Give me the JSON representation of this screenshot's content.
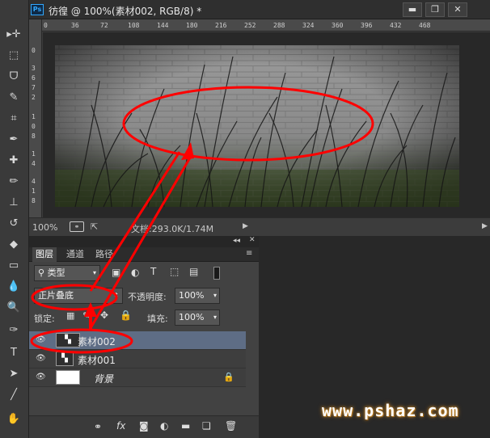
{
  "window": {
    "title": "彷徨 @ 100%(素材002, RGB/8) *",
    "app_badge": "Ps",
    "minimize": "▬",
    "restore": "❐",
    "close": "✕"
  },
  "rulers": {
    "h_ticks": [
      "0",
      "36",
      "72",
      "108",
      "144",
      "180",
      "216",
      "252",
      "288",
      "324",
      "360",
      "396",
      "432",
      "468"
    ],
    "v_ticks": [
      "0",
      "3",
      "6",
      "7",
      "2",
      "1",
      "0",
      "8",
      "1",
      "4",
      "4",
      "1",
      "8"
    ]
  },
  "status": {
    "zoom": "100%",
    "doc_info": "文档:293.0K/1.74M"
  },
  "layers_panel": {
    "tabs": [
      "图层",
      "通道",
      "路径"
    ],
    "filter_kind": "类型",
    "blend_mode": "正片叠底",
    "opacity_label": "不透明度:",
    "opacity_value": "100%",
    "lock_label": "锁定:",
    "fill_label": "填充:",
    "fill_value": "100%",
    "layers": [
      {
        "name": "素材002",
        "selected": true
      },
      {
        "name": "素材001",
        "selected": false
      },
      {
        "name": "背景",
        "selected": false
      }
    ],
    "footer_icons": [
      "link-icon",
      "fx-icon",
      "mask-icon",
      "adjustment-icon",
      "folder-icon",
      "new-layer-icon",
      "trash-icon"
    ]
  },
  "watermark": "www.pshaz.com",
  "colors": {
    "selected_layer": "#5e6d85",
    "annotation_red": "#ff0000",
    "ps_blue": "#31a8ff"
  }
}
